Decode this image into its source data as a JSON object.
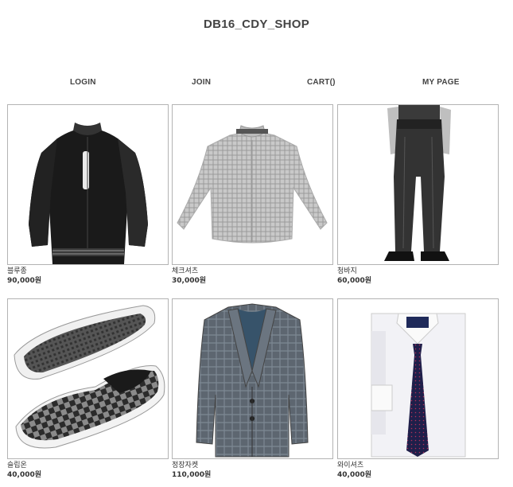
{
  "header": {
    "title": "DB16_CDY_SHOP"
  },
  "nav": {
    "login": "LOGIN",
    "join": "JOIN",
    "cart": "CART()",
    "mypage": "MY PAGE"
  },
  "products": [
    {
      "name": "블루종",
      "price": "90,000원",
      "image": "black-varsity-jacket"
    },
    {
      "name": "체크셔츠",
      "price": "30,000원",
      "image": "grey-check-shirt"
    },
    {
      "name": "청바지",
      "price": "60,000원",
      "image": "black-jeans-model"
    },
    {
      "name": "슬립온",
      "price": "40,000원",
      "image": "checkered-slip-on-shoes"
    },
    {
      "name": "정장자켓",
      "price": "110,000원",
      "image": "grey-check-blazer"
    },
    {
      "name": "와이셔츠",
      "price": "40,000원",
      "image": "white-dress-shirt-tie"
    }
  ]
}
